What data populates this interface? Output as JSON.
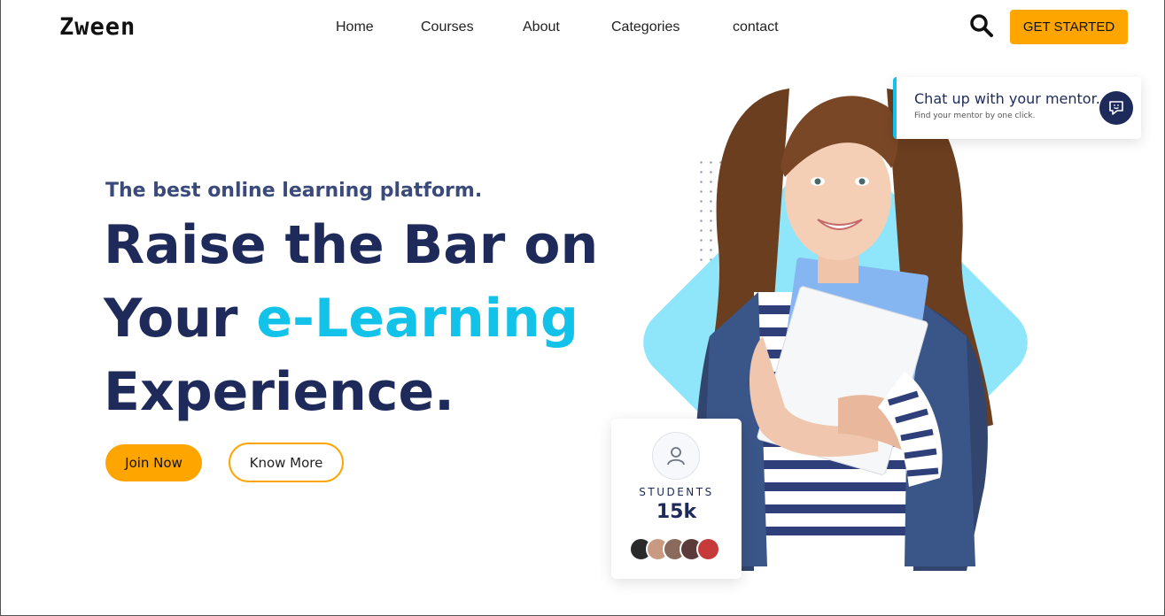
{
  "brand": {
    "logo": "Zween"
  },
  "nav": {
    "items": [
      {
        "label": "Home"
      },
      {
        "label": "Courses"
      },
      {
        "label": "About"
      },
      {
        "label": "Categories"
      },
      {
        "label": "contact"
      }
    ],
    "cta_label": "GET STARTED",
    "search_icon": "search-icon"
  },
  "hero": {
    "tagline": "The best online learning platform.",
    "headline_line1": "Raise the Bar on",
    "headline_line2_a": "Your ",
    "headline_line2_accent": "e-Learning",
    "headline_line3": "Experience.",
    "join_label": "Join Now",
    "know_label": "Know More"
  },
  "chat": {
    "title": "Chat up with your mentor.",
    "subtitle": "Find your mentor by one click.",
    "icon": "chat-icon"
  },
  "students": {
    "label": "STUDENTS",
    "count": "15k",
    "icon": "user-icon"
  },
  "colors": {
    "accent": "#ffa500",
    "navy": "#1e2a5a",
    "cyan": "#12c2e9",
    "diamond": "#8fe6fb"
  }
}
